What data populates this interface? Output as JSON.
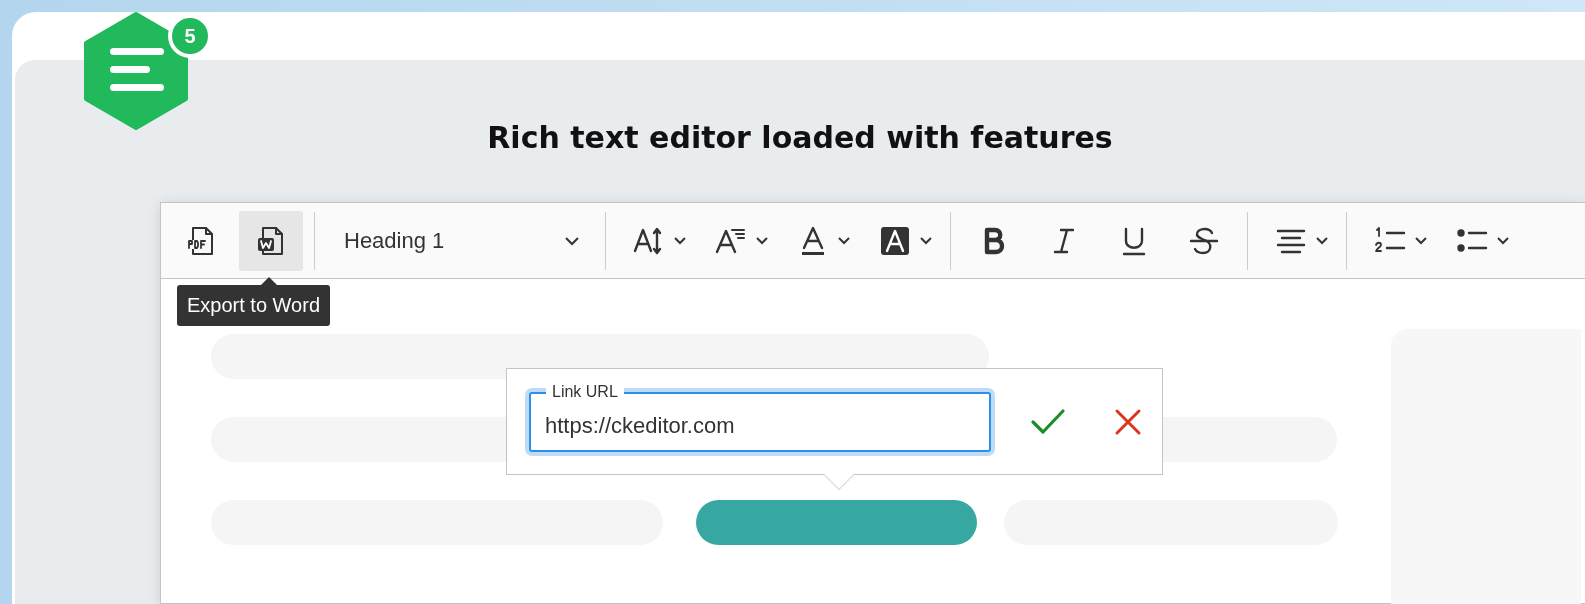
{
  "logo": {
    "badge": "5"
  },
  "title": "Rich text editor loaded with features",
  "toolbar": {
    "items": [
      {
        "kind": "export-pdf",
        "active": false
      },
      {
        "kind": "export-word",
        "active": true
      },
      {
        "kind": "separator"
      },
      {
        "kind": "heading",
        "value": "Heading 1"
      },
      {
        "kind": "separator"
      },
      {
        "kind": "font-size",
        "active": false
      },
      {
        "kind": "font-family",
        "active": false
      },
      {
        "kind": "font-color",
        "active": false
      },
      {
        "kind": "font-background",
        "active": false
      },
      {
        "kind": "separator"
      },
      {
        "kind": "bold",
        "active": false
      },
      {
        "kind": "italic",
        "active": false
      },
      {
        "kind": "underline",
        "active": false
      },
      {
        "kind": "strikethrough",
        "active": false
      },
      {
        "kind": "separator"
      },
      {
        "kind": "alignment",
        "active": false
      },
      {
        "kind": "separator"
      },
      {
        "kind": "numbered-list",
        "active": false
      },
      {
        "kind": "bulleted-list",
        "active": false
      }
    ]
  },
  "tooltip": "Export to Word",
  "link_form": {
    "label": "Link URL",
    "value": "https://ckeditor.com",
    "focused": true
  }
}
